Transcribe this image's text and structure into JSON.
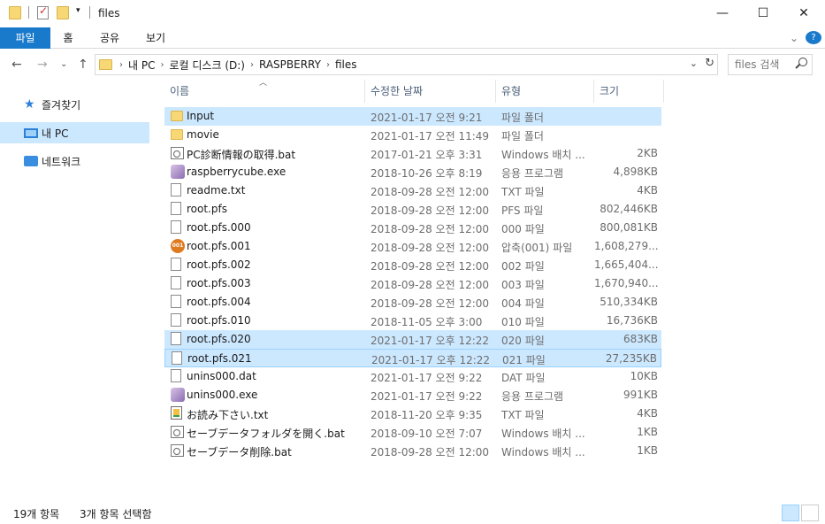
{
  "window": {
    "title": "files",
    "minimize": "—",
    "maximize": "☐",
    "close": "✕"
  },
  "ribbon": {
    "tabs": [
      "파일",
      "홈",
      "공유",
      "보기"
    ],
    "collapse": "⌄",
    "help": "?"
  },
  "nav": {
    "back": "←",
    "forward": "→",
    "recent": "⌄",
    "up": "↑"
  },
  "address": {
    "crumbs": [
      "내 PC",
      "로컬 디스크 (D:)",
      "RASPBERRY",
      "files"
    ],
    "separator": "›"
  },
  "search": {
    "placeholder": "files 검색"
  },
  "navpane": {
    "items": [
      {
        "label": "즐겨찾기",
        "icon": "star-icon"
      },
      {
        "label": "내 PC",
        "icon": "pc-icon",
        "selected": true
      },
      {
        "label": "네트워크",
        "icon": "network-icon"
      }
    ]
  },
  "columns": {
    "name": "이름",
    "date": "수정한 날짜",
    "type": "유형",
    "size": "크기"
  },
  "files": [
    {
      "name": "Input",
      "date": "2021-01-17 오전 9:21",
      "type": "파일 폴더",
      "size": "",
      "icon": "folder",
      "selected": true
    },
    {
      "name": "movie",
      "date": "2021-01-17 오전 11:49",
      "type": "파일 폴더",
      "size": "",
      "icon": "folder"
    },
    {
      "name": "PC診断情報の取得.bat",
      "date": "2017-01-21 오후 3:31",
      "type": "Windows 배치 ...",
      "size": "2KB",
      "icon": "bat"
    },
    {
      "name": "raspberrycube.exe",
      "date": "2018-10-26 오후 8:19",
      "type": "응용 프로그램",
      "size": "4,898KB",
      "icon": "exe"
    },
    {
      "name": "readme.txt",
      "date": "2018-09-28 오전 12:00",
      "type": "TXT 파일",
      "size": "4KB",
      "icon": "doc"
    },
    {
      "name": "root.pfs",
      "date": "2018-09-28 오전 12:00",
      "type": "PFS 파일",
      "size": "802,446KB",
      "icon": "doc"
    },
    {
      "name": "root.pfs.000",
      "date": "2018-09-28 오전 12:00",
      "type": "000 파일",
      "size": "800,081KB",
      "icon": "doc"
    },
    {
      "name": "root.pfs.001",
      "date": "2018-09-28 오전 12:00",
      "type": "압축(001) 파일",
      "size": "1,608,279...",
      "icon": "archive"
    },
    {
      "name": "root.pfs.002",
      "date": "2018-09-28 오전 12:00",
      "type": "002 파일",
      "size": "1,665,404...",
      "icon": "doc"
    },
    {
      "name": "root.pfs.003",
      "date": "2018-09-28 오전 12:00",
      "type": "003 파일",
      "size": "1,670,940...",
      "icon": "doc"
    },
    {
      "name": "root.pfs.004",
      "date": "2018-09-28 오전 12:00",
      "type": "004 파일",
      "size": "510,334KB",
      "icon": "doc"
    },
    {
      "name": "root.pfs.010",
      "date": "2018-11-05 오후 3:00",
      "type": "010 파일",
      "size": "16,736KB",
      "icon": "doc"
    },
    {
      "name": "root.pfs.020",
      "date": "2021-01-17 오후 12:22",
      "type": "020 파일",
      "size": "683KB",
      "icon": "doc",
      "selected": true
    },
    {
      "name": "root.pfs.021",
      "date": "2021-01-17 오후 12:22",
      "type": "021 파일",
      "size": "27,235KB",
      "icon": "doc",
      "selected": true,
      "focused": true
    },
    {
      "name": "unins000.dat",
      "date": "2021-01-17 오전 9:22",
      "type": "DAT 파일",
      "size": "10KB",
      "icon": "doc"
    },
    {
      "name": "unins000.exe",
      "date": "2021-01-17 오전 9:22",
      "type": "응용 프로그램",
      "size": "991KB",
      "icon": "exe"
    },
    {
      "name": "お読み下さい.txt",
      "date": "2018-11-20 오후 9:35",
      "type": "TXT 파일",
      "size": "4KB",
      "icon": "txt"
    },
    {
      "name": "セーブデータフォルダを開く.bat",
      "date": "2018-09-10 오전 7:07",
      "type": "Windows 배치 ...",
      "size": "1KB",
      "icon": "bat"
    },
    {
      "name": "セーブデータ削除.bat",
      "date": "2018-09-28 오전 12:00",
      "type": "Windows 배치 ...",
      "size": "1KB",
      "icon": "bat"
    }
  ],
  "status": {
    "count": "19개 항목",
    "selected": "3개 항목 선택함"
  },
  "colors": {
    "accent": "#1979ca",
    "selection": "#cce8ff",
    "selectionBorder": "#99d1ff"
  }
}
